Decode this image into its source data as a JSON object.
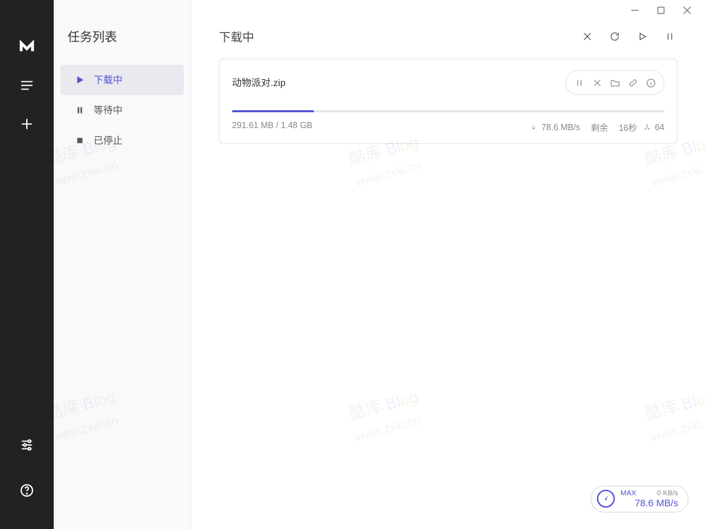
{
  "sidebar": {
    "title": "任务列表",
    "items": [
      {
        "label": "下载中"
      },
      {
        "label": "等待中"
      },
      {
        "label": "已停止"
      }
    ]
  },
  "main": {
    "title": "下载中"
  },
  "task": {
    "name": "动物派对.zip",
    "downloaded": "291.61 MB",
    "total": "1.48 GB",
    "speed": "78.6 MB/s",
    "remaining_label": "剩余",
    "remaining_value": "16秒",
    "connections": "64",
    "progress_percent": 19
  },
  "speed_badge": {
    "max_label": "MAX",
    "up_rate": "0 KB/s",
    "down_rate": "78.6 MB/s"
  },
  "watermark": {
    "line1a": "酷库 ",
    "line1_b": "B",
    "line1_l": "l",
    "line1_o": "o",
    "line1_g": "g",
    "line2": "www.zxki.cn"
  }
}
